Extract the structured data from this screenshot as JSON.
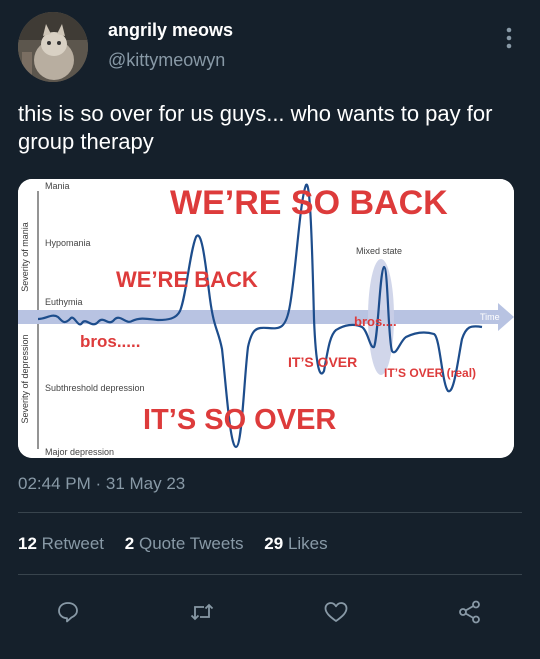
{
  "user": {
    "name": "angrily meows",
    "handle": "@kittymeowyn"
  },
  "tweet": {
    "text": "this is so over for us guys... who wants to pay for group therapy",
    "timestamp": "02:44 PM · 31 May 23"
  },
  "meme": {
    "axis_mania": "Severity of mania",
    "axis_depression": "Severity of depression",
    "levels": {
      "mania": "Mania",
      "hypomania": "Hypomania",
      "euthymia": "Euthymia",
      "subthreshold": "Subthreshold depression",
      "major": "Major depression"
    },
    "time_label": "Time",
    "mixed_state": "Mixed state",
    "captions": {
      "so_back": "WE’RE SO BACK",
      "back": "WE’RE BACK",
      "bros1": "bros.....",
      "so_over": "IT’S SO OVER",
      "its_over": "IT’S OVER",
      "bros2": "bros....",
      "over_real": "IT’S OVER (real)"
    }
  },
  "stats": {
    "retweets_count": "12",
    "retweets_label": "Retweet",
    "quotes_count": "2",
    "quotes_label": "Quote Tweets",
    "likes_count": "29",
    "likes_label": "Likes"
  },
  "icons": [
    "more-icon",
    "reply-icon",
    "retweet-icon",
    "like-icon",
    "share-icon"
  ]
}
